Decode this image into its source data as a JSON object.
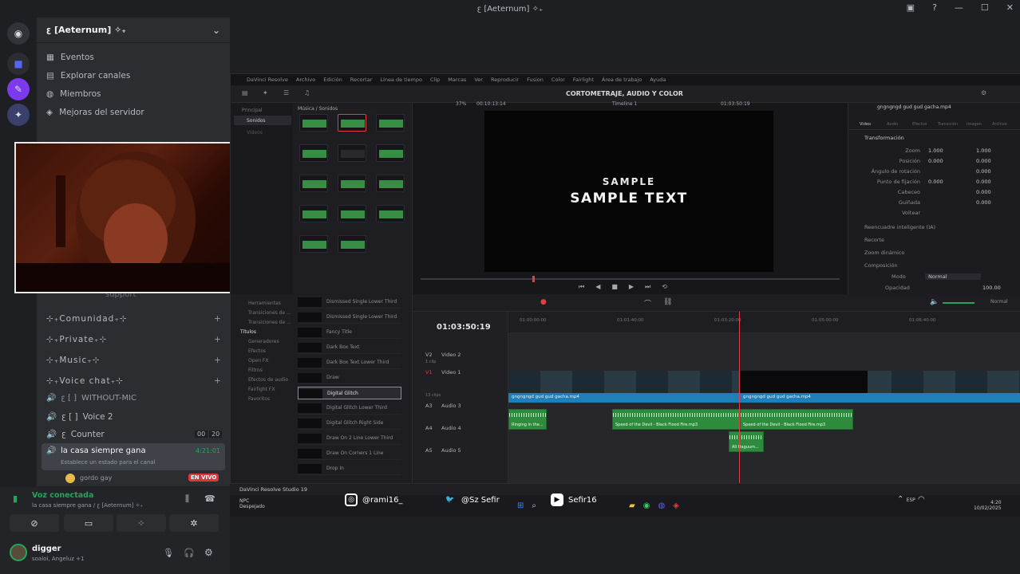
{
  "window": {
    "title": "ꜫ [Aeternum] ✧₊",
    "controls": [
      "▣",
      "?",
      "—",
      "☐",
      "✕"
    ]
  },
  "server": {
    "name": "ꜫ [Aeternum] ✧₊",
    "nav": [
      {
        "label": "Eventos",
        "icon": "calendar-icon"
      },
      {
        "label": "Explorar canales",
        "icon": "browse-icon"
      },
      {
        "label": "Miembros",
        "icon": "members-icon"
      },
      {
        "label": "Mejoras del servidor",
        "icon": "boost-icon"
      }
    ],
    "support_channel": "support",
    "categories": [
      "⊹₊Comunidad₊⊹",
      "⊹₊Private₊⊹",
      "⊹₊Music₊⊹",
      "⊹₊Voice chat₊⊹"
    ],
    "channels": [
      {
        "label": "WITHOUT-MIC",
        "prefix": "ꜫ [ ]"
      },
      {
        "label": "Voice 2",
        "prefix": "ꜫ [ ]"
      },
      {
        "label": "Counter",
        "prefix": "ꜫ",
        "badge_a": "00",
        "badge_b": "20"
      }
    ],
    "active_voice": {
      "name": "la casa siempre gana",
      "timer": "4:21:01",
      "status_placeholder": "Establece un estado para el canal"
    },
    "live_member": {
      "name": "gordo gay",
      "badge": "EN VIVO"
    }
  },
  "voice": {
    "status": "Voz conectada",
    "location": "la casa siempre gana / ꜫ [Aeternum] ✧₊"
  },
  "user": {
    "name": "digger",
    "status": "soaloi, Angeluz +1"
  },
  "resolve": {
    "menu": [
      "DaVinci Resolve",
      "Archivo",
      "Edición",
      "Recortar",
      "Línea de tiempo",
      "Clip",
      "Marcas",
      "Ver",
      "Reproducir",
      "Fusion",
      "Color",
      "Fairlight",
      "Área de trabajo",
      "Ayuda"
    ],
    "project_title": "CORTOMETRAJE, AUDIO Y COLOR",
    "viewer": {
      "zoom": "37%",
      "timecode_left": "00:10:13:14",
      "timeline_name": "Timeline 1",
      "timecode_right": "01:03:50:19",
      "text_line1": "SAMPLE",
      "text_line2": "SAMPLE TEXT"
    },
    "media": {
      "header": "Música / Sonidos",
      "side_items": [
        "Principal",
        "Sonidos",
        "Videos"
      ]
    },
    "inspector": {
      "filename": "gngngngd gud gud gacha.mp4",
      "tabs": [
        "Video",
        "Audio",
        "Efectos",
        "Transición",
        "Imagen",
        "Archivo"
      ],
      "section": "Transformación",
      "rows": [
        {
          "label": "Zoom",
          "v1": "1.000",
          "v2": "1.000"
        },
        {
          "label": "Posición",
          "v1": "0.000",
          "v2": "0.000"
        },
        {
          "label": "Ángulo de rotación",
          "v1": "",
          "v2": "0.000"
        },
        {
          "label": "Punto de fijación",
          "v1": "0.000",
          "v2": "0.000"
        },
        {
          "label": "Cabeceo",
          "v1": "",
          "v2": "0.000"
        },
        {
          "label": "Guiñada",
          "v1": "",
          "v2": "0.000"
        },
        {
          "label": "Voltear",
          "v1": "",
          "v2": ""
        }
      ],
      "sections": [
        "Reencuadre inteligente (IA)",
        "Recorte",
        "Zoom dinámico",
        "Composición"
      ],
      "blend_mode_label": "Modo",
      "blend_mode": "Normal",
      "opacity_label": "Opacidad",
      "opacity": "100.00"
    },
    "effects": {
      "side": [
        "Herramientas",
        "Transiciones de ...",
        "Transiciones de ...",
        "Títulos",
        "Generadores",
        "Efectos",
        "Open FX",
        "Filtros",
        "Efectos de audio",
        "Fairlight FX",
        "Favoritos"
      ],
      "items": [
        "Dismissed Single Lower Third",
        "Dismissed Single Lower Third",
        "Fancy Title",
        "Dark Box Text",
        "Dark Box Text Lower Third",
        "Draw",
        "Digital Glitch",
        "Digital Glitch Lower Third",
        "Digital Glitch Right Side",
        "Draw On 2 Line Lower Third",
        "Draw On Corners 1 Line",
        "Drop In"
      ]
    },
    "timeline": {
      "timecode": "01:03:50:19",
      "ruler": [
        "01:00:00:00",
        "01:01:40:00",
        "01:03:20:00",
        "01:05:00:00",
        "01:06:40:00"
      ],
      "tracks": [
        {
          "id": "V2",
          "name": "Video 2",
          "sub": ""
        },
        {
          "id": "V1",
          "name": "Video 1",
          "sub": "1 clip"
        },
        {
          "id": "A3",
          "name": "Audio 3",
          "sub": "13 clips"
        },
        {
          "id": "A4",
          "name": "Audio 4",
          "sub": ""
        },
        {
          "id": "A5",
          "name": "Audio 5",
          "sub": ""
        }
      ],
      "clips": {
        "v1": "gngngngd gud gud gacha.mp4",
        "a_left": "Ringing in the...",
        "a_mid": "Speed of the Devil - Black Flood Fire.mp3",
        "a_right": "Speed of the Devil - Black Flood Fire.mp3",
        "a4": "All Haguum..."
      },
      "volume_label": "Normal"
    },
    "bottom_label": "DaVinci Resolve Studio 19"
  },
  "taskbar": {
    "social": [
      {
        "label": "@rami16_",
        "icon": "instagram-icon"
      },
      {
        "label": "@Sz Sefir",
        "icon": "twitter-icon"
      },
      {
        "label": "Sefir16",
        "icon": "youtube-icon"
      }
    ],
    "app_label": "NPC",
    "app_sub": "Despejado",
    "tray_time": "4:20",
    "tray_date": "10/02/2025",
    "lang": "ESP"
  }
}
